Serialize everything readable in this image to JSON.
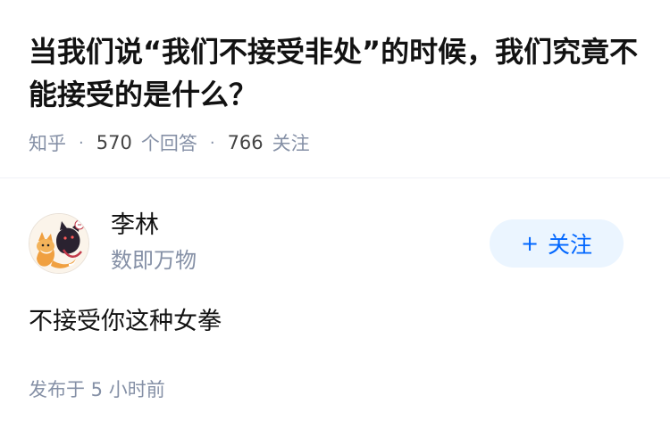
{
  "question": {
    "title": "当我们说“我们不接受非处”的时候，我们究竟不能接受的是什么？",
    "source": "知乎",
    "separator": "·",
    "answer_count": "570",
    "answer_count_label": "个回答",
    "follower_count": "766",
    "follower_count_label": "关注"
  },
  "answer": {
    "author": {
      "name": "李林",
      "headline": "数即万物",
      "avatar_icon": "cartoon-fox-cat-avatar"
    },
    "follow_button": {
      "icon": "+",
      "label": "关注"
    },
    "content": "不接受你这种女拳",
    "publish_time": "发布于 5 小时前"
  },
  "colors": {
    "accent": "#0066ff",
    "follow_bg": "#ebf5ff",
    "meta_text": "#8590a6",
    "primary_text": "#121212"
  }
}
